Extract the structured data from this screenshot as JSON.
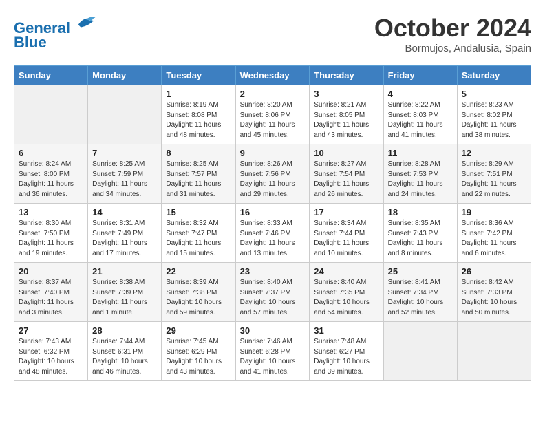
{
  "header": {
    "logo_line1": "General",
    "logo_line2": "Blue",
    "month": "October 2024",
    "location": "Bormujos, Andalusia, Spain"
  },
  "days_of_week": [
    "Sunday",
    "Monday",
    "Tuesday",
    "Wednesday",
    "Thursday",
    "Friday",
    "Saturday"
  ],
  "weeks": [
    [
      {
        "day": "",
        "sunrise": "",
        "sunset": "",
        "daylight": "",
        "empty": true
      },
      {
        "day": "",
        "sunrise": "",
        "sunset": "",
        "daylight": "",
        "empty": true
      },
      {
        "day": "1",
        "sunrise": "Sunrise: 8:19 AM",
        "sunset": "Sunset: 8:08 PM",
        "daylight": "Daylight: 11 hours and 48 minutes.",
        "empty": false
      },
      {
        "day": "2",
        "sunrise": "Sunrise: 8:20 AM",
        "sunset": "Sunset: 8:06 PM",
        "daylight": "Daylight: 11 hours and 45 minutes.",
        "empty": false
      },
      {
        "day": "3",
        "sunrise": "Sunrise: 8:21 AM",
        "sunset": "Sunset: 8:05 PM",
        "daylight": "Daylight: 11 hours and 43 minutes.",
        "empty": false
      },
      {
        "day": "4",
        "sunrise": "Sunrise: 8:22 AM",
        "sunset": "Sunset: 8:03 PM",
        "daylight": "Daylight: 11 hours and 41 minutes.",
        "empty": false
      },
      {
        "day": "5",
        "sunrise": "Sunrise: 8:23 AM",
        "sunset": "Sunset: 8:02 PM",
        "daylight": "Daylight: 11 hours and 38 minutes.",
        "empty": false
      }
    ],
    [
      {
        "day": "6",
        "sunrise": "Sunrise: 8:24 AM",
        "sunset": "Sunset: 8:00 PM",
        "daylight": "Daylight: 11 hours and 36 minutes.",
        "empty": false
      },
      {
        "day": "7",
        "sunrise": "Sunrise: 8:25 AM",
        "sunset": "Sunset: 7:59 PM",
        "daylight": "Daylight: 11 hours and 34 minutes.",
        "empty": false
      },
      {
        "day": "8",
        "sunrise": "Sunrise: 8:25 AM",
        "sunset": "Sunset: 7:57 PM",
        "daylight": "Daylight: 11 hours and 31 minutes.",
        "empty": false
      },
      {
        "day": "9",
        "sunrise": "Sunrise: 8:26 AM",
        "sunset": "Sunset: 7:56 PM",
        "daylight": "Daylight: 11 hours and 29 minutes.",
        "empty": false
      },
      {
        "day": "10",
        "sunrise": "Sunrise: 8:27 AM",
        "sunset": "Sunset: 7:54 PM",
        "daylight": "Daylight: 11 hours and 26 minutes.",
        "empty": false
      },
      {
        "day": "11",
        "sunrise": "Sunrise: 8:28 AM",
        "sunset": "Sunset: 7:53 PM",
        "daylight": "Daylight: 11 hours and 24 minutes.",
        "empty": false
      },
      {
        "day": "12",
        "sunrise": "Sunrise: 8:29 AM",
        "sunset": "Sunset: 7:51 PM",
        "daylight": "Daylight: 11 hours and 22 minutes.",
        "empty": false
      }
    ],
    [
      {
        "day": "13",
        "sunrise": "Sunrise: 8:30 AM",
        "sunset": "Sunset: 7:50 PM",
        "daylight": "Daylight: 11 hours and 19 minutes.",
        "empty": false
      },
      {
        "day": "14",
        "sunrise": "Sunrise: 8:31 AM",
        "sunset": "Sunset: 7:49 PM",
        "daylight": "Daylight: 11 hours and 17 minutes.",
        "empty": false
      },
      {
        "day": "15",
        "sunrise": "Sunrise: 8:32 AM",
        "sunset": "Sunset: 7:47 PM",
        "daylight": "Daylight: 11 hours and 15 minutes.",
        "empty": false
      },
      {
        "day": "16",
        "sunrise": "Sunrise: 8:33 AM",
        "sunset": "Sunset: 7:46 PM",
        "daylight": "Daylight: 11 hours and 13 minutes.",
        "empty": false
      },
      {
        "day": "17",
        "sunrise": "Sunrise: 8:34 AM",
        "sunset": "Sunset: 7:44 PM",
        "daylight": "Daylight: 11 hours and 10 minutes.",
        "empty": false
      },
      {
        "day": "18",
        "sunrise": "Sunrise: 8:35 AM",
        "sunset": "Sunset: 7:43 PM",
        "daylight": "Daylight: 11 hours and 8 minutes.",
        "empty": false
      },
      {
        "day": "19",
        "sunrise": "Sunrise: 8:36 AM",
        "sunset": "Sunset: 7:42 PM",
        "daylight": "Daylight: 11 hours and 6 minutes.",
        "empty": false
      }
    ],
    [
      {
        "day": "20",
        "sunrise": "Sunrise: 8:37 AM",
        "sunset": "Sunset: 7:40 PM",
        "daylight": "Daylight: 11 hours and 3 minutes.",
        "empty": false
      },
      {
        "day": "21",
        "sunrise": "Sunrise: 8:38 AM",
        "sunset": "Sunset: 7:39 PM",
        "daylight": "Daylight: 11 hours and 1 minute.",
        "empty": false
      },
      {
        "day": "22",
        "sunrise": "Sunrise: 8:39 AM",
        "sunset": "Sunset: 7:38 PM",
        "daylight": "Daylight: 10 hours and 59 minutes.",
        "empty": false
      },
      {
        "day": "23",
        "sunrise": "Sunrise: 8:40 AM",
        "sunset": "Sunset: 7:37 PM",
        "daylight": "Daylight: 10 hours and 57 minutes.",
        "empty": false
      },
      {
        "day": "24",
        "sunrise": "Sunrise: 8:40 AM",
        "sunset": "Sunset: 7:35 PM",
        "daylight": "Daylight: 10 hours and 54 minutes.",
        "empty": false
      },
      {
        "day": "25",
        "sunrise": "Sunrise: 8:41 AM",
        "sunset": "Sunset: 7:34 PM",
        "daylight": "Daylight: 10 hours and 52 minutes.",
        "empty": false
      },
      {
        "day": "26",
        "sunrise": "Sunrise: 8:42 AM",
        "sunset": "Sunset: 7:33 PM",
        "daylight": "Daylight: 10 hours and 50 minutes.",
        "empty": false
      }
    ],
    [
      {
        "day": "27",
        "sunrise": "Sunrise: 7:43 AM",
        "sunset": "Sunset: 6:32 PM",
        "daylight": "Daylight: 10 hours and 48 minutes.",
        "empty": false
      },
      {
        "day": "28",
        "sunrise": "Sunrise: 7:44 AM",
        "sunset": "Sunset: 6:31 PM",
        "daylight": "Daylight: 10 hours and 46 minutes.",
        "empty": false
      },
      {
        "day": "29",
        "sunrise": "Sunrise: 7:45 AM",
        "sunset": "Sunset: 6:29 PM",
        "daylight": "Daylight: 10 hours and 43 minutes.",
        "empty": false
      },
      {
        "day": "30",
        "sunrise": "Sunrise: 7:46 AM",
        "sunset": "Sunset: 6:28 PM",
        "daylight": "Daylight: 10 hours and 41 minutes.",
        "empty": false
      },
      {
        "day": "31",
        "sunrise": "Sunrise: 7:48 AM",
        "sunset": "Sunset: 6:27 PM",
        "daylight": "Daylight: 10 hours and 39 minutes.",
        "empty": false
      },
      {
        "day": "",
        "sunrise": "",
        "sunset": "",
        "daylight": "",
        "empty": true
      },
      {
        "day": "",
        "sunrise": "",
        "sunset": "",
        "daylight": "",
        "empty": true
      }
    ]
  ]
}
